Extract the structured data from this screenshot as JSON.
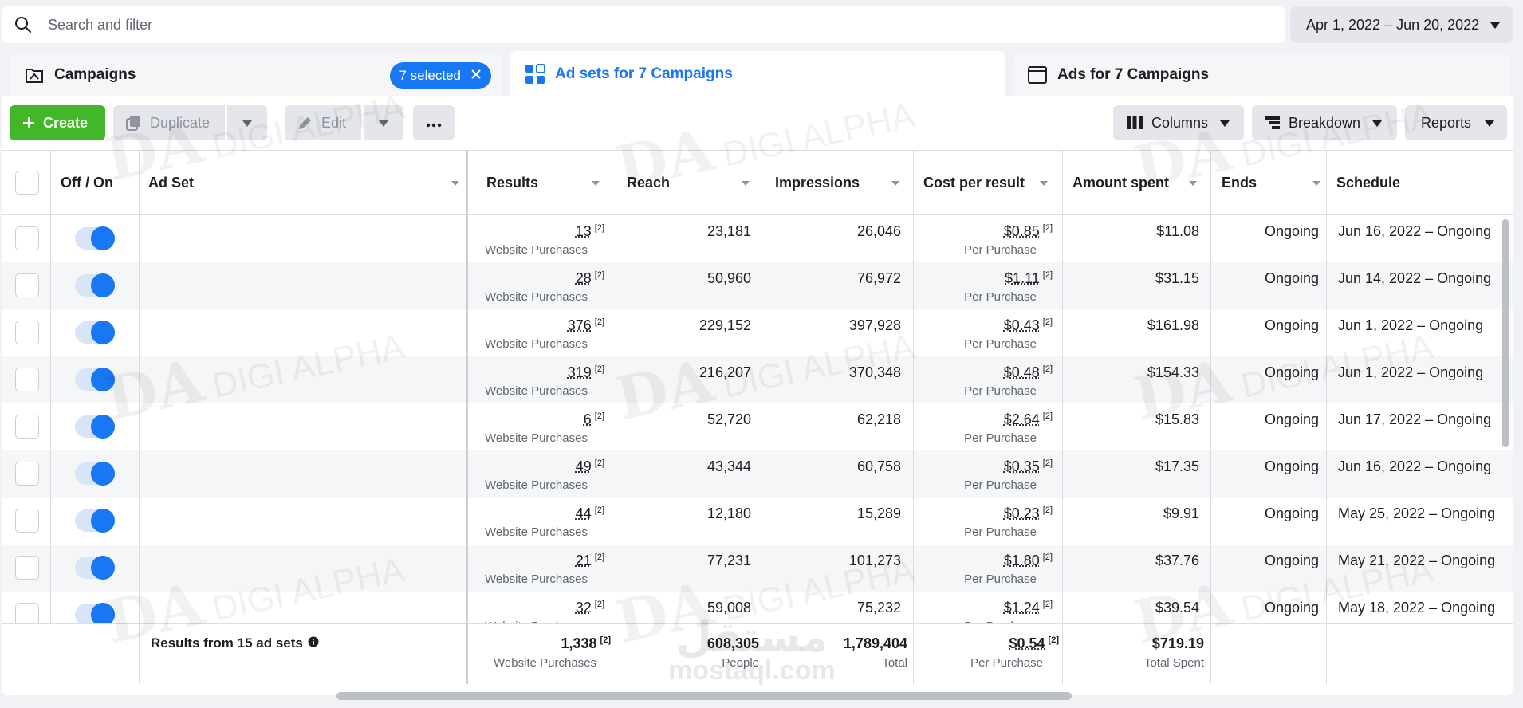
{
  "search": {
    "placeholder": "Search and filter"
  },
  "date_range": "Apr 1, 2022 – Jun 20, 2022",
  "tabs": [
    {
      "label": "Campaigns",
      "chip": "7 selected"
    },
    {
      "label": "Ad sets for 7 Campaigns"
    },
    {
      "label": "Ads for 7 Campaigns"
    }
  ],
  "toolbar": {
    "create": "Create",
    "duplicate": "Duplicate",
    "edit": "Edit",
    "columns": "Columns",
    "breakdown": "Breakdown",
    "reports": "Reports"
  },
  "columns": {
    "offon": "Off / On",
    "adset": "Ad Set",
    "results": "Results",
    "reach": "Reach",
    "impressions": "Impressions",
    "cpr": "Cost per result",
    "spent": "Amount spent",
    "ends": "Ends",
    "schedule": "Schedule"
  },
  "superscript": "[2]",
  "rows": [
    {
      "results": "13",
      "results_type": "Website Purchases",
      "reach": "23,181",
      "impressions": "26,046",
      "cpr": "$0.85",
      "cpr_type": "Per Purchase",
      "spent": "$11.08",
      "ends": "Ongoing",
      "schedule": "Jun 16, 2022 – Ongoing"
    },
    {
      "results": "28",
      "results_type": "Website Purchases",
      "reach": "50,960",
      "impressions": "76,972",
      "cpr": "$1.11",
      "cpr_type": "Per Purchase",
      "spent": "$31.15",
      "ends": "Ongoing",
      "schedule": "Jun 14, 2022 – Ongoing"
    },
    {
      "results": "376",
      "results_type": "Website Purchases",
      "reach": "229,152",
      "impressions": "397,928",
      "cpr": "$0.43",
      "cpr_type": "Per Purchase",
      "spent": "$161.98",
      "ends": "Ongoing",
      "schedule": "Jun 1, 2022 – Ongoing"
    },
    {
      "results": "319",
      "results_type": "Website Purchases",
      "reach": "216,207",
      "impressions": "370,348",
      "cpr": "$0.48",
      "cpr_type": "Per Purchase",
      "spent": "$154.33",
      "ends": "Ongoing",
      "schedule": "Jun 1, 2022 – Ongoing"
    },
    {
      "results": "6",
      "results_type": "Website Purchases",
      "reach": "52,720",
      "impressions": "62,218",
      "cpr": "$2.64",
      "cpr_type": "Per Purchase",
      "spent": "$15.83",
      "ends": "Ongoing",
      "schedule": "Jun 17, 2022 – Ongoing"
    },
    {
      "results": "49",
      "results_type": "Website Purchases",
      "reach": "43,344",
      "impressions": "60,758",
      "cpr": "$0.35",
      "cpr_type": "Per Purchase",
      "spent": "$17.35",
      "ends": "Ongoing",
      "schedule": "Jun 16, 2022 – Ongoing"
    },
    {
      "results": "44",
      "results_type": "Website Purchases",
      "reach": "12,180",
      "impressions": "15,289",
      "cpr": "$0.23",
      "cpr_type": "Per Purchase",
      "spent": "$9.91",
      "ends": "Ongoing",
      "schedule": "May 25, 2022 – Ongoing"
    },
    {
      "results": "21",
      "results_type": "Website Purchases",
      "reach": "77,231",
      "impressions": "101,273",
      "cpr": "$1.80",
      "cpr_type": "Per Purchase",
      "spent": "$37.76",
      "ends": "Ongoing",
      "schedule": "May 21, 2022 – Ongoing"
    },
    {
      "results": "32",
      "results_type": "Website Purchases",
      "reach": "59,008",
      "impressions": "75,232",
      "cpr": "$1.24",
      "cpr_type": "Per Purchase",
      "spent": "$39.54",
      "ends": "Ongoing",
      "schedule": "May 18, 2022 – Ongoing"
    }
  ],
  "totals": {
    "label": "Results from 15 ad sets",
    "results": "1,338",
    "results_type": "Website Purchases",
    "reach": "608,305",
    "reach_type": "People",
    "impressions": "1,789,404",
    "impressions_type": "Total",
    "cpr": "$0.54",
    "cpr_type": "Per Purchase",
    "spent": "$719.19",
    "spent_type": "Total Spent"
  },
  "watermark": {
    "logo": "DA",
    "text": "DIGI ALPHA",
    "site_arabic": "مستقل",
    "site": "mostaql.com"
  },
  "colors": {
    "accent": "#1877f2",
    "create_green": "#42b72a"
  }
}
